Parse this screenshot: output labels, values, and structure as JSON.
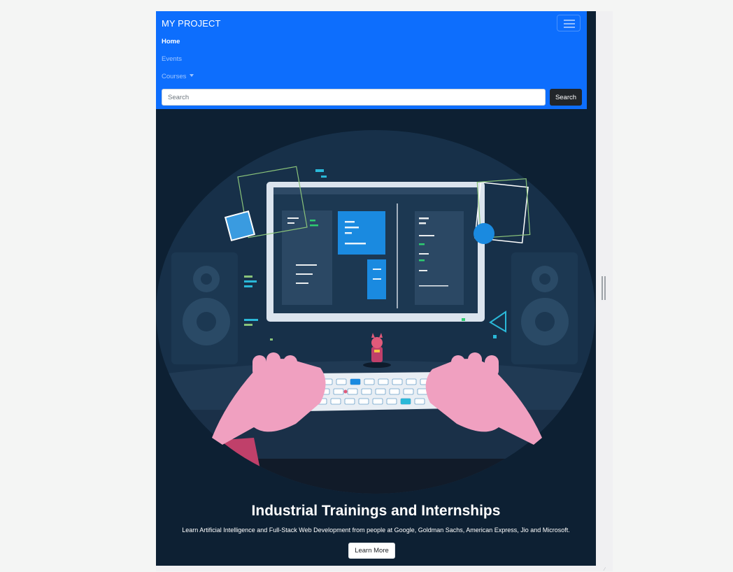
{
  "navbar": {
    "brand": "MY PROJECT",
    "links": [
      {
        "label": "Home",
        "active": true
      },
      {
        "label": "Events",
        "active": false
      },
      {
        "label": "Courses",
        "active": false,
        "dropdown": true
      }
    ],
    "search": {
      "placeholder": "Search",
      "value": "",
      "button_label": "Search"
    },
    "toggler_icon": "hamburger-menu-icon"
  },
  "hero": {
    "illustration": "developer-at-computer-illustration",
    "title": "Industrial Trainings and Internships",
    "subtitle": "Learn Artificial Intelligence and Full-Stack Web Development from people at Google, Goldman Sachs, American Express, Jio and Microsoft.",
    "button_label": "Learn More"
  },
  "colors": {
    "navbar_bg": "#0d6efd",
    "hero_bg": "#0d2033",
    "search_button_bg": "#212529",
    "accent_pink": "#f0a0c0"
  }
}
